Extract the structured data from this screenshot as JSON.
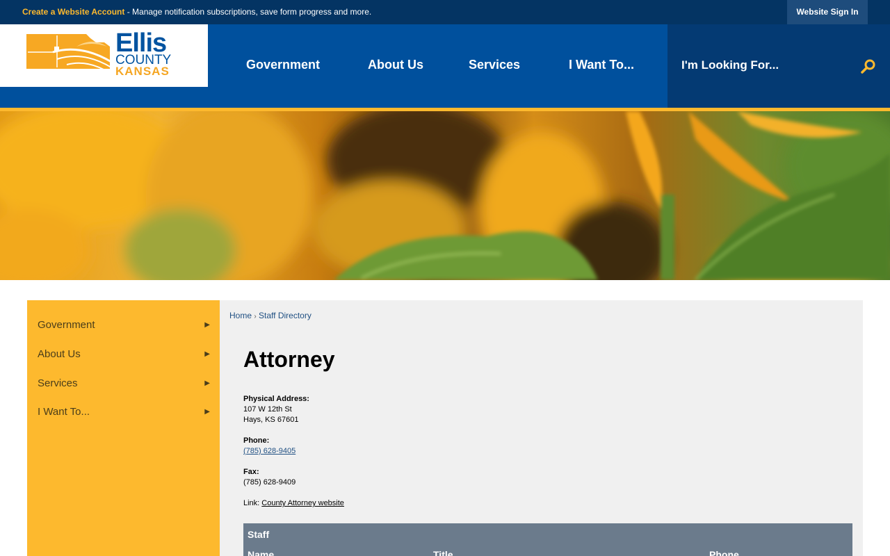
{
  "topbar": {
    "create_account_link": "Create a Website Account",
    "create_account_text": " - Manage notification subscriptions, save form progress and more.",
    "sign_in": "Website Sign In"
  },
  "logo": {
    "line1": "Ellis",
    "line2": "COUNTY",
    "line3": "KANSAS"
  },
  "nav": {
    "items": [
      "Government",
      "About Us",
      "Services",
      "I Want To..."
    ]
  },
  "search": {
    "placeholder": "I'm Looking For..."
  },
  "sidebar": {
    "items": [
      {
        "label": "Government"
      },
      {
        "label": "About Us"
      },
      {
        "label": "Services"
      },
      {
        "label": "I Want To..."
      }
    ]
  },
  "breadcrumb": {
    "home": "Home",
    "separator": "›",
    "current": "Staff Directory"
  },
  "page": {
    "title": "Attorney",
    "address_label": "Physical Address:",
    "address_line1": "107 W 12th St",
    "address_line2": "Hays, KS 67601",
    "phone_label": "Phone:",
    "phone": "(785) 628-9405",
    "fax_label": "Fax:",
    "fax": "(785) 628-9409",
    "link_label": "Link: ",
    "link_text": "County Attorney website"
  },
  "staff_table": {
    "caption": "Staff",
    "columns": [
      "Name",
      "Title",
      "Phone"
    ]
  },
  "colors": {
    "brand_blue": "#00509d",
    "dark_blue": "#043463",
    "gold": "#fdb92e",
    "content_bg": "#f0f0f0",
    "table_header": "#6b7b8c"
  }
}
